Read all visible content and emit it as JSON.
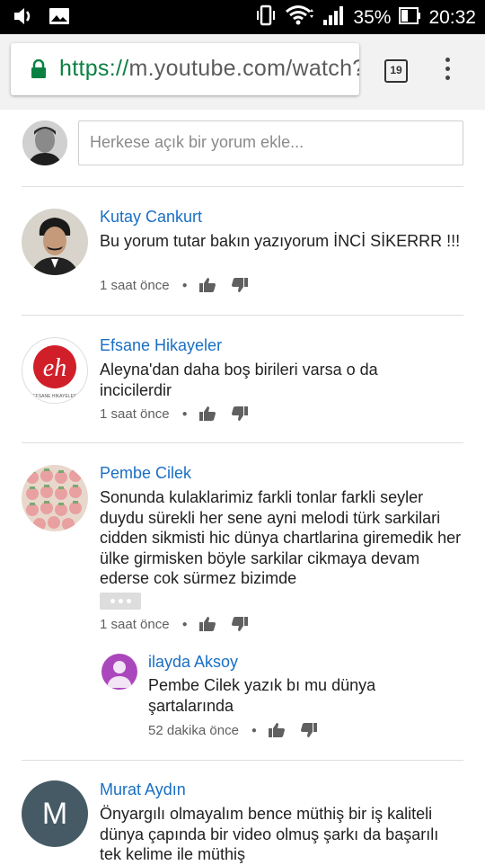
{
  "statusbar": {
    "battery": "35%",
    "time": "20:32"
  },
  "browser": {
    "url_scheme": "https://",
    "url_host": "m.youtube.com/watch?",
    "tab_count": "19"
  },
  "composer": {
    "placeholder": "Herkese açık bir yorum ekle..."
  },
  "comments": [
    {
      "author": "Kutay Cankurt",
      "text": "Bu yorum tutar bakın yazıyorum İNCİ SİKERRR !!!",
      "time": "1 saat önce"
    },
    {
      "author": "Efsane Hikayeler",
      "text": "Aleyna'dan daha boş birileri varsa o da incicilerdir",
      "time": "1 saat önce",
      "avatar_text": "eh",
      "avatar_caption": "EFSANE HIKAYELER"
    },
    {
      "author": "Pembe Cilek",
      "text": "Sonunda kulaklarimiz farkli tonlar farkli seyler duydu sürekli her sene ayni melodi türk sarkilari cidden sikmisti hic dünya chartlarina giremedik her ülke girmisken böyle sarkilar cikmaya devam ederse cok sürmez bizimde",
      "time": "1 saat önce",
      "reply": {
        "author": "ilayda Aksoy",
        "text": "Pembe Cilek yazık bı mu dünya şartalarında",
        "time": "52 dakika önce"
      }
    },
    {
      "author": "Murat Aydın",
      "text": "Önyargılı olmayalım bence müthiş bir iş kaliteli dünya çapında bir video olmuş şarkı da başarılı tek kelime ile müthiş",
      "avatar_letter": "M"
    }
  ],
  "colors": {
    "author_link": "#1a6fc4",
    "secure_green": "#0b8043",
    "reply_avatar": "#ab47bc",
    "letter_avatar": "#455a64"
  }
}
